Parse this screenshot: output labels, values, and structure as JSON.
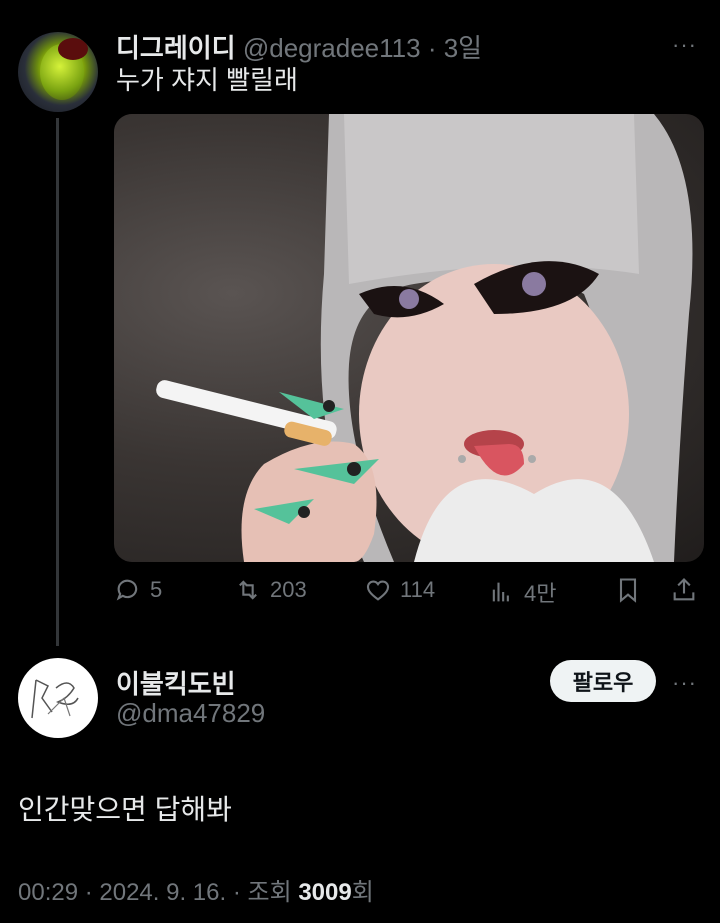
{
  "tweet": {
    "display_name": "디그레이디",
    "handle": "@degradee113",
    "separator": "·",
    "time": "3일",
    "text": "누가 쟈지 빨릴래",
    "more": "···",
    "actions": {
      "reply_count": "5",
      "retweet_count": "203",
      "like_count": "114",
      "view_count": "4만"
    },
    "icons": {
      "reply": "reply-icon",
      "retweet": "retweet-icon",
      "like": "heart-icon",
      "views": "views-icon",
      "bookmark": "bookmark-icon",
      "share": "share-icon"
    }
  },
  "reply": {
    "display_name": "이불킥도빈",
    "handle": "@dma47829",
    "follow_label": "팔로우",
    "more": "···",
    "text": "인간맞으면 답해봐",
    "meta_time": "00:29",
    "meta_sep1": " · ",
    "meta_date": "2024. 9. 16.",
    "meta_sep2": " · ",
    "meta_views_prefix": "조회 ",
    "meta_views_count": "3009",
    "meta_views_suffix": "회"
  },
  "colors": {
    "background": "#000000",
    "primary_text": "#e7e9ea",
    "secondary_text": "#71767b",
    "follow_button_bg": "#eff3f4"
  }
}
